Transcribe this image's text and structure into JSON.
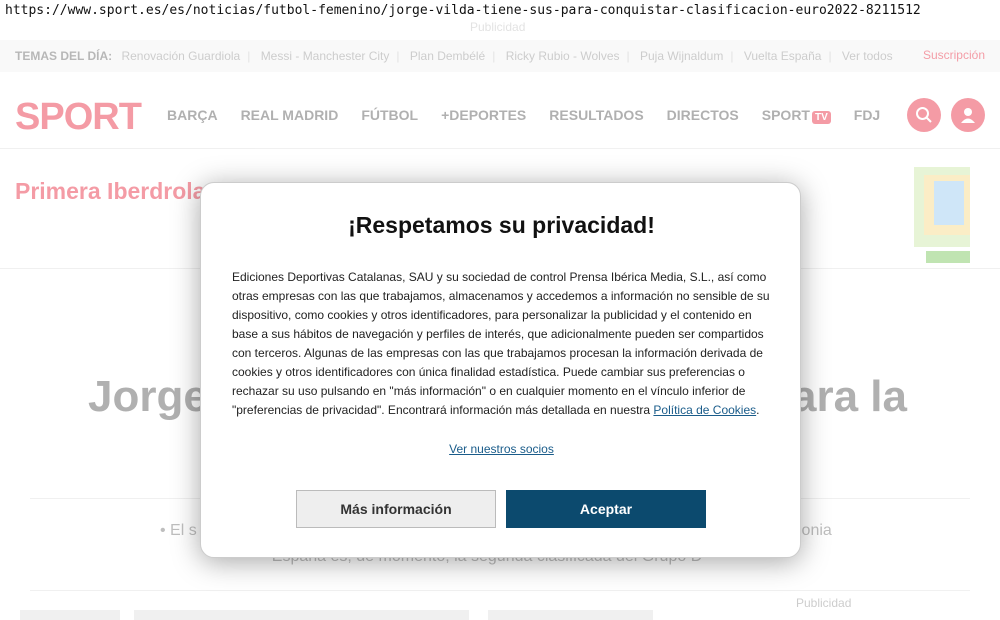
{
  "browser": {
    "url": "https://www.sport.es/es/noticias/futbol-femenino/jorge-vilda-tiene-sus-para-conquistar-clasificacion-euro2022-8211512"
  },
  "ads": {
    "top_label": "Publicidad",
    "bottom_label": "Publicidad"
  },
  "topics": {
    "label": "TEMAS DEL DÍA:",
    "items": [
      "Renovación Guardiola",
      "Messi - Manchester City",
      "Plan Dembélé",
      "Ricky Rubio - Wolves",
      "Puja Wijnaldum",
      "Vuelta España",
      "Ver todos"
    ],
    "subscribe": "Suscripción"
  },
  "nav": {
    "logo": "SPORT",
    "items": [
      "BARÇA",
      "REAL MADRID",
      "FÚTBOL",
      "+DEPORTES",
      "RESULTADOS",
      "DIRECTOS",
      "SPORT",
      "FDJ"
    ],
    "tv_badge": "TV"
  },
  "section": {
    "title": "Primera Iberdrola"
  },
  "article": {
    "headline_left": "Jorge",
    "headline_right": "ara la",
    "bullet1_left": "• El s",
    "bullet1_right": "lonia",
    "bullet2": "· España es, de momento, la segunda clasificada del Grupo D"
  },
  "modal": {
    "title": "¡Respetamos su privacidad!",
    "body": "Ediciones Deportivas Catalanas, SAU y su sociedad de control Prensa Ibérica Media, S.L., así como otras empresas con las que trabajamos, almacenamos y accedemos a información no sensible de su dispositivo, como cookies y otros identificadores, para personalizar la publicidad y el contenido en base a sus hábitos de navegación y perfiles de interés, que adicionalmente pueden ser compartidos con terceros. Algunas de las empresas con las que trabajamos procesan la información derivada de cookies y otros identificadores con única finalidad estadística. Puede cambiar sus preferencias o rechazar su uso pulsando en \"más información\" o en cualquier momento en el vínculo inferior de \"preferencias de privacidad\". Encontrará información más detallada en nuestra ",
    "cookie_link": "Política de Cookies",
    "period": ".",
    "partners_link": "Ver nuestros socios",
    "more_button": "Más información",
    "accept_button": "Aceptar"
  },
  "colors": {
    "brand": "#e5132a",
    "accept": "#0c4a6e"
  }
}
